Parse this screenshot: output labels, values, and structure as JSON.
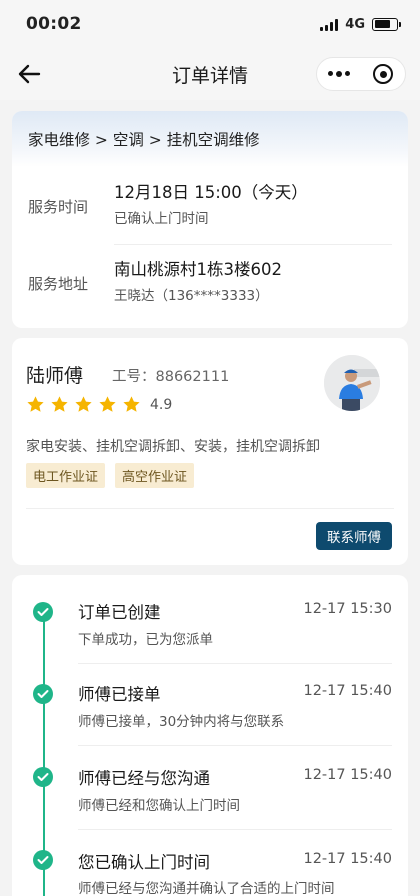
{
  "status_bar": {
    "time": "00:02",
    "network": "4G",
    "battery_level": 0.75
  },
  "nav": {
    "title": "订单详情"
  },
  "order": {
    "breadcrumb": "家电维修 > 空调 > 挂机空调维修",
    "service_time": {
      "label": "服务时间",
      "value": "12月18日  15:00（今天）",
      "note": "已确认上门时间"
    },
    "service_address": {
      "label": "服务地址",
      "value": "南山桃源村1栋3楼602",
      "contact": "王晓达（136****3333）"
    }
  },
  "master": {
    "name": "陆师傅",
    "employee_no": "工号：88662111",
    "stars": 5,
    "rating": "4.9",
    "skills": "家电安装、挂机空调拆卸、安装，挂机空调拆卸",
    "certificates": [
      "电工作业证",
      "高空作业证"
    ],
    "contact_label": "联系师傅"
  },
  "timeline": [
    {
      "title": "订单已创建",
      "time": "12-17 15:30",
      "desc": "下单成功，已为您派单"
    },
    {
      "title": "师傅已接单",
      "time": "12-17 15:40",
      "desc": "师傅已接单，30分钟内将与您联系"
    },
    {
      "title": "师傅已经与您沟通",
      "time": "12-17 15:40",
      "desc": "师傅已经和您确认上门时间"
    },
    {
      "title": "您已确认上门时间",
      "time": "12-17 15:40",
      "desc": "师傅已经与您沟通并确认了合适的上门时间"
    }
  ],
  "colors": {
    "accent_green": "#1fb589",
    "button_blue": "#0e4a6e",
    "star_yellow": "#f5b400",
    "tag_bg": "#f8ecd2"
  }
}
